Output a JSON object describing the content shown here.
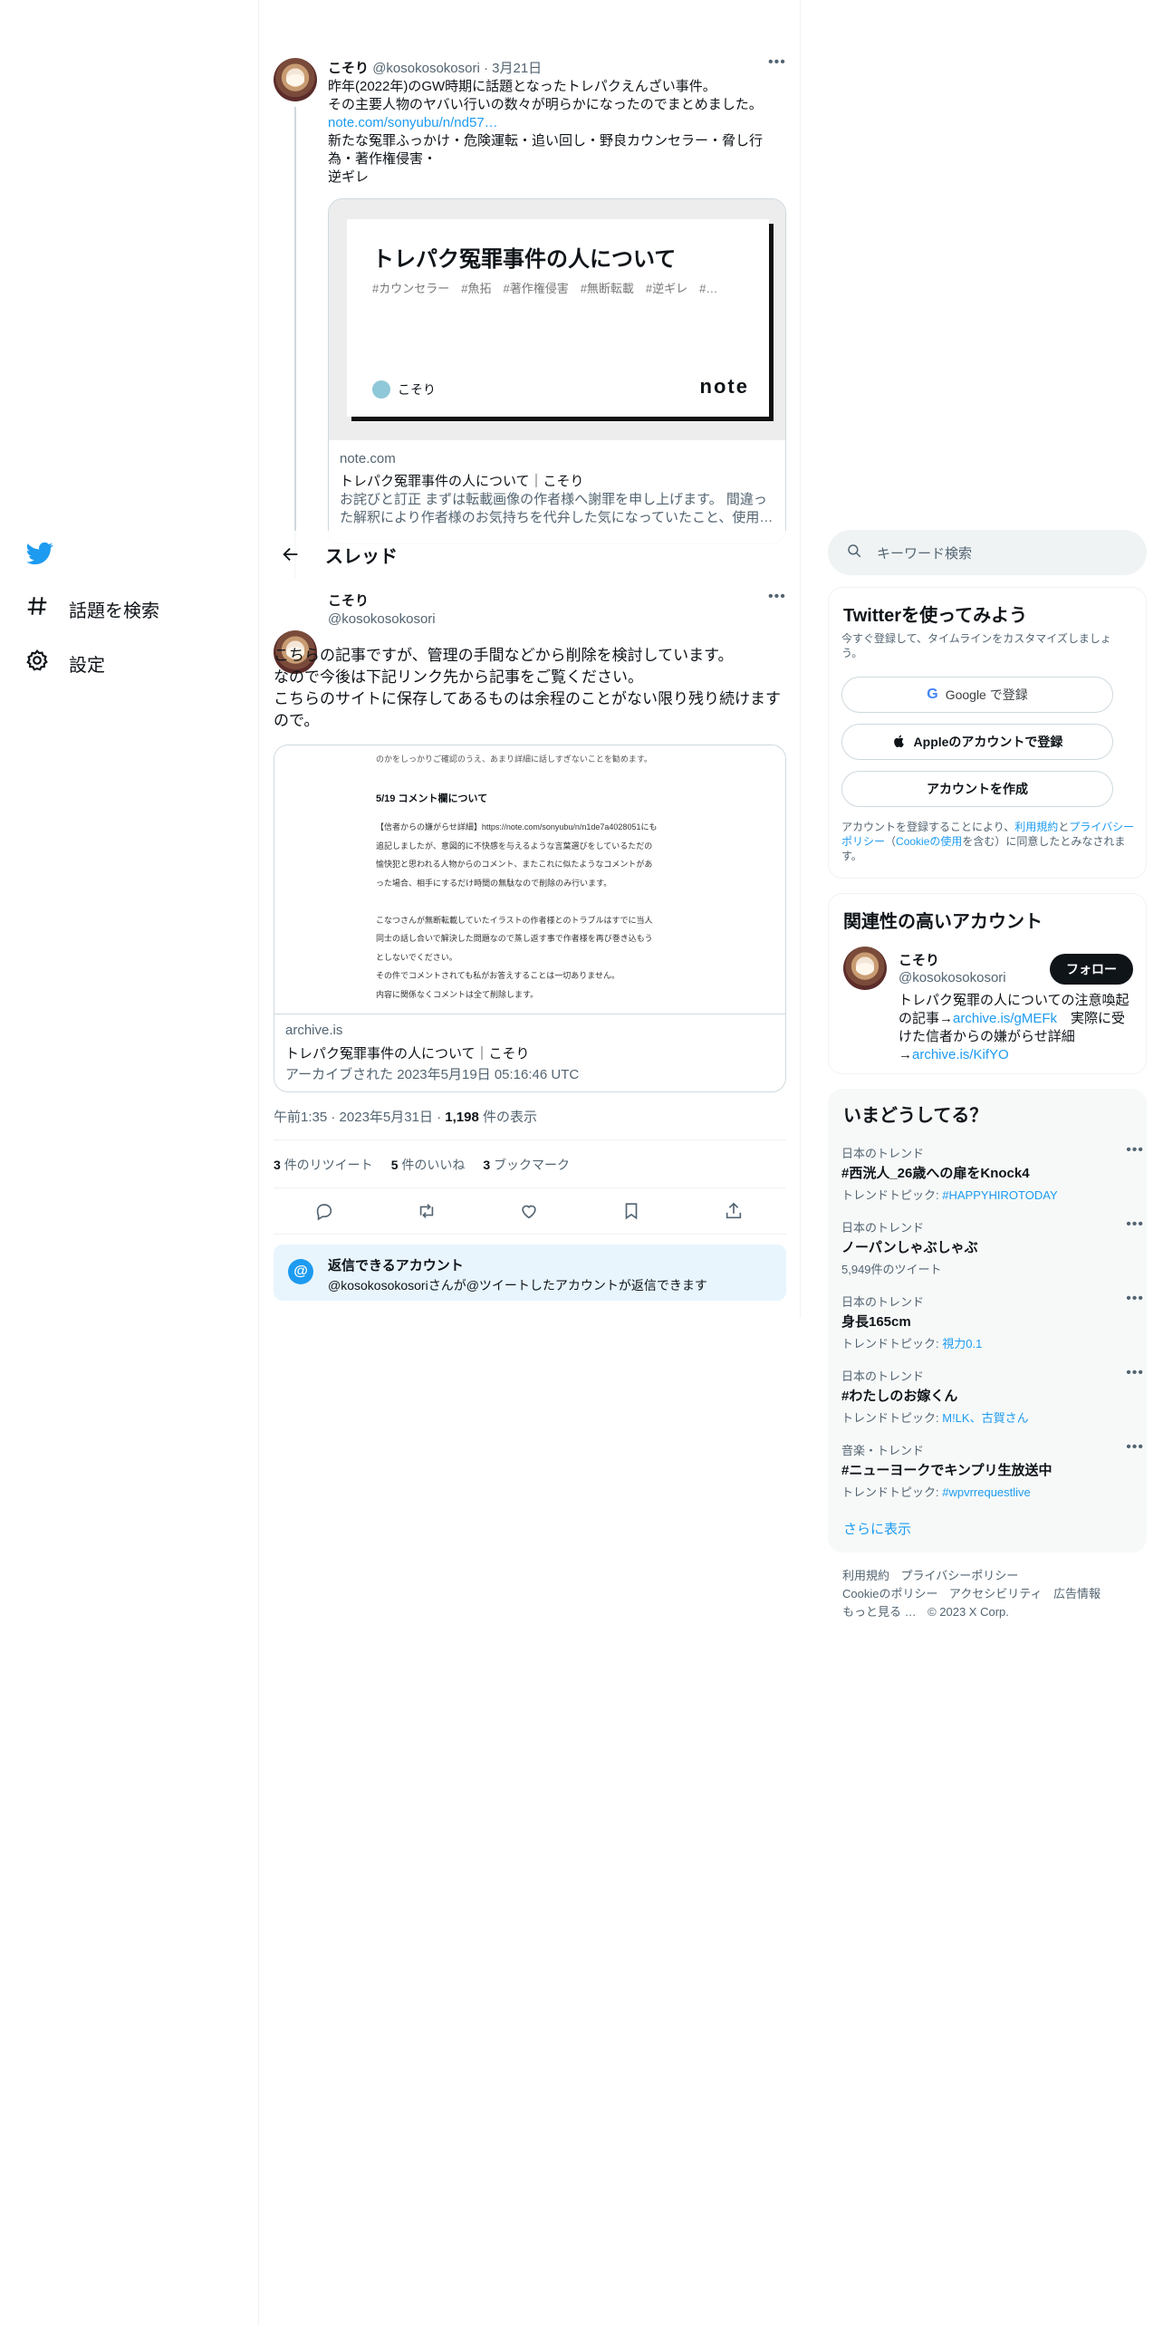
{
  "nav": {
    "explore_label": "話題を検索",
    "settings_label": "設定"
  },
  "prev_tweet": {
    "name": "こそり",
    "handle": "@kosokosokosori",
    "date": "3月21日",
    "lines": [
      "昨年(2022年)のGW時期に話題となったトレパクえんざい事件。",
      "その主要人物のヤバい行いの数々が明らかになったのでまとめました。"
    ],
    "link": "note.com/sonyubu/n/nd57…",
    "lines2": [
      "新たな冤罪ふっかけ・危険運転・追い回し・野良カウンセラー・脅し行",
      "為・著作権侵害・",
      "逆ギレ"
    ],
    "card": {
      "image_title": "トレパク冤罪事件の人について",
      "image_tags": "#カウンセラー　#魚拓　#著作権侵害　#無断転載　#逆ギレ　#…",
      "image_author": "こそり",
      "image_brand": "note",
      "domain": "note.com",
      "title": "トレパク冤罪事件の人について｜こそり",
      "desc1": "お詫びと訂正 まずは転載画像の作者様へ謝罪を申し上げます。 間違っ",
      "desc2": "た解釈により作者様のお気持ちを代弁した気になっていたこと、使用…"
    }
  },
  "header": {
    "title": "スレッド"
  },
  "tweet": {
    "name": "こそり",
    "handle": "@kosokosokosori",
    "lines": [
      "こちらの記事ですが、管理の手間などから削除を検討しています。",
      "なので今後は下記リンク先から記事をご覧ください。",
      "こちらのサイトに保存してあるものは余程のことがない限り残り続けます",
      "ので。"
    ],
    "card": {
      "shot_line0": "のかをしっかりご確認のうえ、あまり詳細に話しすぎないことを勧めます。",
      "shot_heading": "5/19 コメント欄について",
      "shot_lines": [
        "【信者からの嫌がらせ詳細】https://note.com/sonyubu/n/n1de7a4028051にも",
        "追記しましたが、意図的に不快感を与えるような言葉選びをしているただの",
        "愉快犯と思われる人物からのコメント、またこれに似たようなコメントがあ",
        "った場合、相手にするだけ時間の無駄なので削除のみ行います。",
        "",
        "こなつさんが無断転載していたイラストの作者様とのトラブルはすでに当人",
        "同士の話し合いで解決した問題なので蒸し返す事で作者様を再び巻き込もう",
        "としないでください。",
        "その件でコメントされても私がお答えすることは一切ありません。",
        "内容に関係なくコメントは全て削除します。"
      ],
      "domain": "archive.is",
      "title": "トレパク冤罪事件の人について｜こそり",
      "archived": "アーカイブされた 2023年5月19日 05:16:46 UTC"
    },
    "time": "午前1:35",
    "date": "2023年5月31日",
    "views_count": "1,198",
    "views_label": "件の表示",
    "retweets_count": "3",
    "retweets_label": "件のリツイート",
    "likes_count": "5",
    "likes_label": "件のいいね",
    "bookmarks_count": "3",
    "bookmarks_label": "ブックマーク",
    "reply_title": "返信できるアカウント",
    "reply_desc": "@kosokosokosoriさんが@ツイートしたアカウントが返信できます"
  },
  "search": {
    "placeholder": "キーワード検索"
  },
  "signup": {
    "title": "Twitterを使ってみよう",
    "desc": "今すぐ登録して、タイムラインをカスタマイズしましょう。",
    "google_label": "Google で登録",
    "apple_label": "Appleのアカウントで登録",
    "create_label": "アカウントを作成",
    "legal_1": "アカウントを登録することにより、",
    "terms": "利用規約",
    "and": "と",
    "privacy": "プライバシーポリシー",
    "legal_2": "（",
    "cookie": "Cookieの使用",
    "legal_3": "を含む）に同意したとみなされます。"
  },
  "related": {
    "title": "関連性の高いアカウント",
    "name": "こそり",
    "handle": "@kosokosokosori",
    "follow_label": "フォロー",
    "bio_1": "トレパク冤罪の人についての注意喚起の記事→",
    "bio_link1": "archive.is/gMEFk",
    "bio_2": "　実際に受けた信者からの嫌がらせ詳細→",
    "bio_link2": "archive.is/KifYO"
  },
  "trends": {
    "title": "いまどうしてる？",
    "items": [
      {
        "cat": "日本のトレンド",
        "name": "#西洸人_26歳への扉をKnock4",
        "sub_prefix": "トレンドトピック: ",
        "sub_link": "#HAPPYHIROTODAY",
        "sub_plain": ""
      },
      {
        "cat": "日本のトレンド",
        "name": "ノーパンしゃぶしゃぶ",
        "sub_prefix": "",
        "sub_link": "",
        "sub_plain": "5,949件のツイート"
      },
      {
        "cat": "日本のトレンド",
        "name": "身長165cm",
        "sub_prefix": "トレンドトピック: ",
        "sub_link": "視力0.1",
        "sub_plain": ""
      },
      {
        "cat": "日本のトレンド",
        "name": "#わたしのお嫁くん",
        "sub_prefix": "トレンドトピック: ",
        "sub_link": "M!LK、古賀さん",
        "sub_plain": ""
      },
      {
        "cat": "音楽・トレンド",
        "name": "#ニューヨークでキンプリ生放送中",
        "sub_prefix": "トレンドトピック: ",
        "sub_link": "#wpvrrequestlive",
        "sub_plain": ""
      }
    ],
    "more_label": "さらに表示"
  },
  "footer": {
    "terms": "利用規約",
    "privacy": "プライバシーポリシー",
    "cookie": "Cookieのポリシー",
    "accessibility": "アクセシビリティ",
    "ads": "広告情報",
    "more": "もっと見る …",
    "copyright": "© 2023 X Corp."
  },
  "colors": {
    "accent": "#1d9bf0",
    "text": "#0f1419",
    "muted": "#536471"
  }
}
